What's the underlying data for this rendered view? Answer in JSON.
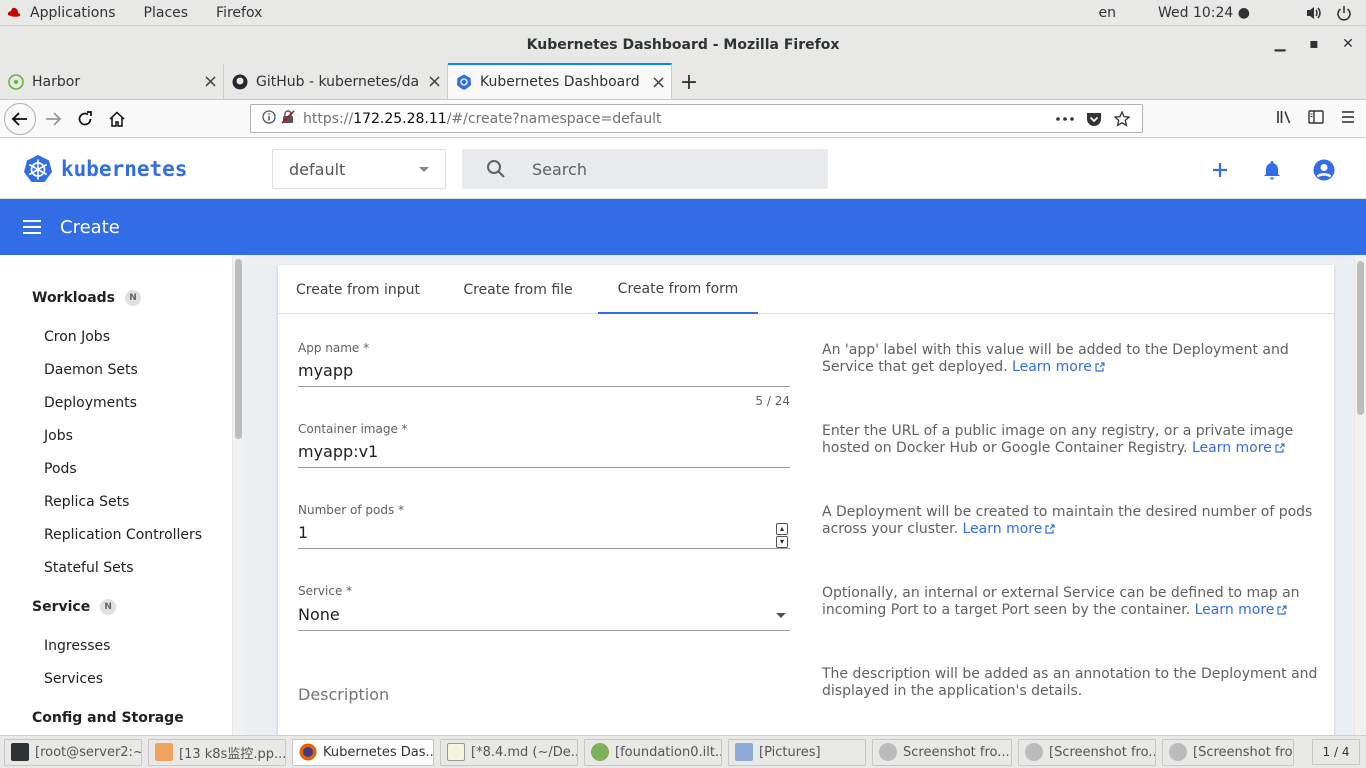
{
  "gnome": {
    "applications": "Applications",
    "places": "Places",
    "firefox": "Firefox",
    "lang": "en",
    "clock": "Wed 10:24 ●"
  },
  "window": {
    "title": "Kubernetes Dashboard - Mozilla Firefox"
  },
  "tabs": [
    {
      "label": "Harbor"
    },
    {
      "label": "GitHub - kubernetes/dashboard"
    },
    {
      "label": "Kubernetes Dashboard"
    }
  ],
  "urlbar": {
    "prefix": "https://",
    "host": "172.25.28.11",
    "suffix": "/#/create?namespace=default"
  },
  "app": {
    "logo_text": "kubernetes",
    "namespace": "default",
    "search_placeholder": "Search",
    "page_title": "Create"
  },
  "sidebar": {
    "workloads": {
      "label": "Workloads",
      "badge": "N"
    },
    "workload_items": [
      "Cron Jobs",
      "Daemon Sets",
      "Deployments",
      "Jobs",
      "Pods",
      "Replica Sets",
      "Replication Controllers",
      "Stateful Sets"
    ],
    "service": {
      "label": "Service",
      "badge": "N"
    },
    "service_items": [
      "Ingresses",
      "Services"
    ],
    "config": {
      "label": "Config and Storage"
    }
  },
  "create_tabs": [
    "Create from input",
    "Create from file",
    "Create from form"
  ],
  "form": {
    "app_name": {
      "label": "App name *",
      "value": "myapp",
      "counter": "5 / 24"
    },
    "container_image": {
      "label": "Container image *",
      "value": "myapp:v1"
    },
    "pods": {
      "label": "Number of pods *",
      "value": "1"
    },
    "service": {
      "label": "Service *",
      "value": "None"
    },
    "description": {
      "label": "Description"
    }
  },
  "help": {
    "app_name": "An 'app' label with this value will be added to the Deployment and Service that get deployed.",
    "container_image": "Enter the URL of a public image on any registry, or a private image hosted on Docker Hub or Google Container Registry.",
    "pods": "A Deployment will be created to maintain the desired number of pods across your cluster.",
    "service": "Optionally, an internal or external Service can be defined to map an incoming Port to a target Port seen by the container.",
    "description": "The description will be added as an annotation to the Deployment and displayed in the application's details.",
    "learn_more": "Learn more"
  },
  "taskbar": {
    "items": [
      "[root@server2:~]",
      "[13 k8s监控.pp...",
      "Kubernetes Das...",
      "[*8.4.md (~/De...",
      "[foundation0.ilt....",
      "[Pictures]",
      "Screenshot fro...",
      "[Screenshot fro...",
      "[Screenshot fro..."
    ],
    "pager": "1 / 4"
  },
  "colors": {
    "brand": "#326de6",
    "tab_accent": "#0a84ff"
  }
}
